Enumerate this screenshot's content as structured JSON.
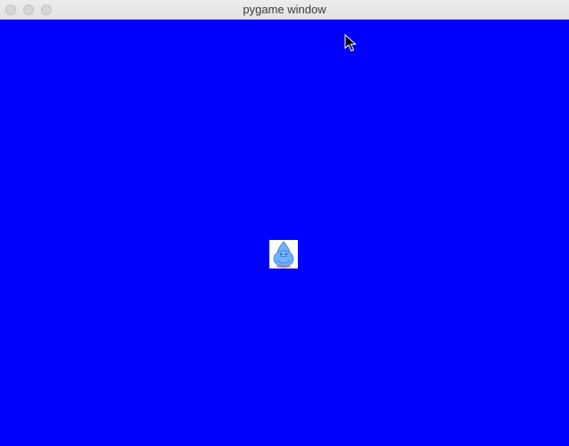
{
  "window": {
    "title": "pygame window"
  },
  "canvas": {
    "background_color": "#0000ff"
  },
  "sprite": {
    "icon": "blue-blob-character-icon",
    "body_color": "#6fb0ff",
    "background_color": "#ffffff"
  },
  "cursor": {
    "icon": "mouse-pointer-icon"
  }
}
